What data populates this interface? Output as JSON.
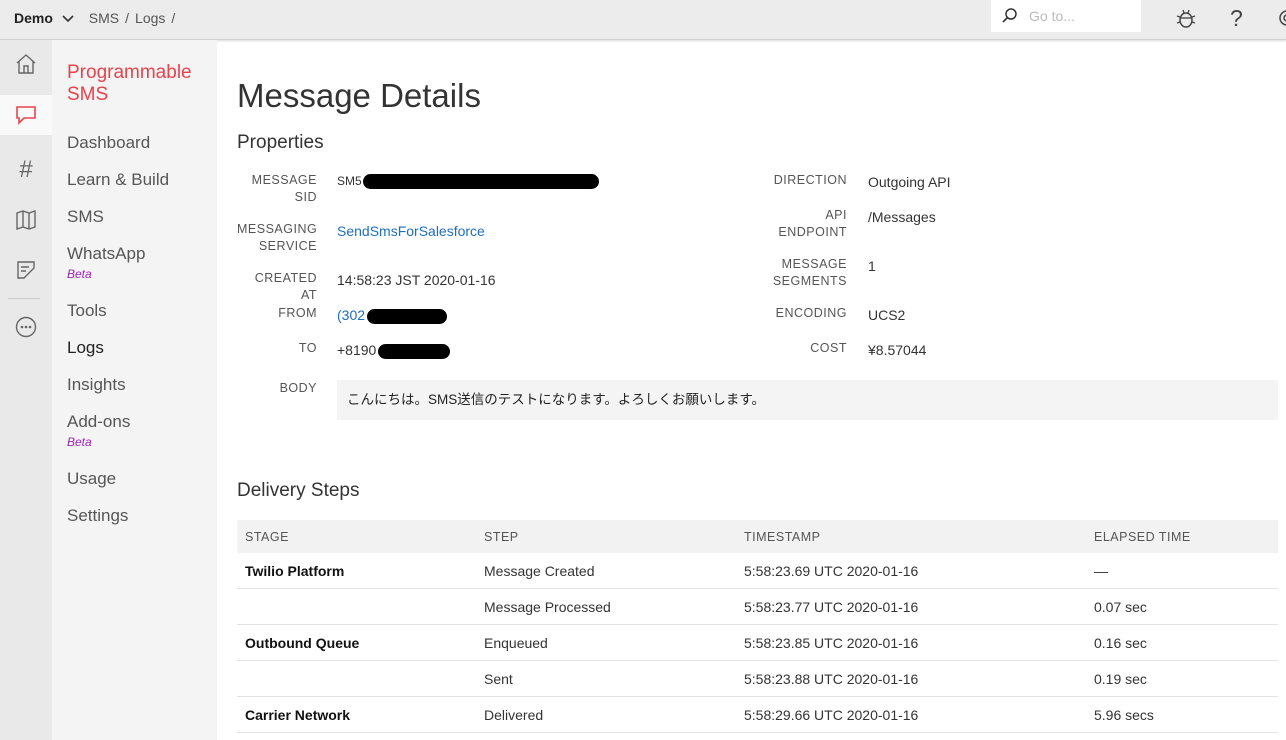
{
  "topbar": {
    "account": "Demo",
    "breadcrumbs": [
      "SMS",
      "Logs"
    ],
    "search_placeholder": "Go to...",
    "icons": [
      "search-icon",
      "debugger-icon",
      "help-icon",
      "settings-icon"
    ]
  },
  "rail": {
    "icons": [
      "home-icon",
      "chat-icon",
      "hash-icon",
      "map-icon",
      "notes-icon",
      "more-icon"
    ],
    "active": "chat-icon"
  },
  "sidebar": {
    "product_title": "Programmable SMS",
    "items": [
      {
        "label": "Dashboard"
      },
      {
        "label": "Learn & Build"
      },
      {
        "label": "SMS"
      },
      {
        "label": "WhatsApp",
        "badge": "Beta"
      },
      {
        "label": "Tools"
      },
      {
        "label": "Logs",
        "active": true
      },
      {
        "label": "Insights"
      },
      {
        "label": "Add-ons",
        "badge": "Beta"
      },
      {
        "label": "Usage"
      },
      {
        "label": "Settings"
      }
    ]
  },
  "page": {
    "title": "Message Details",
    "properties_title": "Properties",
    "properties_left": [
      {
        "label": "MESSAGE SID",
        "value": "SM5"
      },
      {
        "label": "MESSAGING SERVICE",
        "value": "SendSmsForSalesforce"
      },
      {
        "label": "CREATED AT",
        "value": "14:58:23 JST 2020-01-16"
      },
      {
        "label": "FROM",
        "value": "(302"
      },
      {
        "label": "TO",
        "value": "+8190"
      },
      {
        "label": "BODY",
        "value": "こんにちは。SMS送信のテストになります。よろしくお願いします。"
      }
    ],
    "properties_right": [
      {
        "label": "DIRECTION",
        "value": "Outgoing API"
      },
      {
        "label": "API ENDPOINT",
        "value": "/Messages"
      },
      {
        "label": "MESSAGE SEGMENTS",
        "value": "1"
      },
      {
        "label": "ENCODING",
        "value": "UCS2"
      },
      {
        "label": "COST",
        "value": "¥8.57044"
      }
    ],
    "delivery_title": "Delivery Steps",
    "delivery_columns": [
      "STAGE",
      "STEP",
      "TIMESTAMP",
      "ELAPSED TIME"
    ],
    "delivery_rows": [
      {
        "stage": "Twilio Platform",
        "step": "Message Created",
        "timestamp": "5:58:23.69 UTC 2020-01-16",
        "elapsed": "—"
      },
      {
        "stage": "",
        "step": "Message Processed",
        "timestamp": "5:58:23.77 UTC 2020-01-16",
        "elapsed": "0.07 sec"
      },
      {
        "stage": "Outbound Queue",
        "step": "Enqueued",
        "timestamp": "5:58:23.85 UTC 2020-01-16",
        "elapsed": "0.16 sec"
      },
      {
        "stage": "",
        "step": "Sent",
        "timestamp": "5:58:23.88 UTC 2020-01-16",
        "elapsed": "0.19 sec"
      },
      {
        "stage": "Carrier Network",
        "step": "Delivered",
        "timestamp": "5:58:29.66 UTC 2020-01-16",
        "elapsed": "5.96 secs"
      }
    ]
  },
  "colors": {
    "brand": "#e8434c",
    "link": "#1e6fbf",
    "beta": "#9c27b0"
  }
}
